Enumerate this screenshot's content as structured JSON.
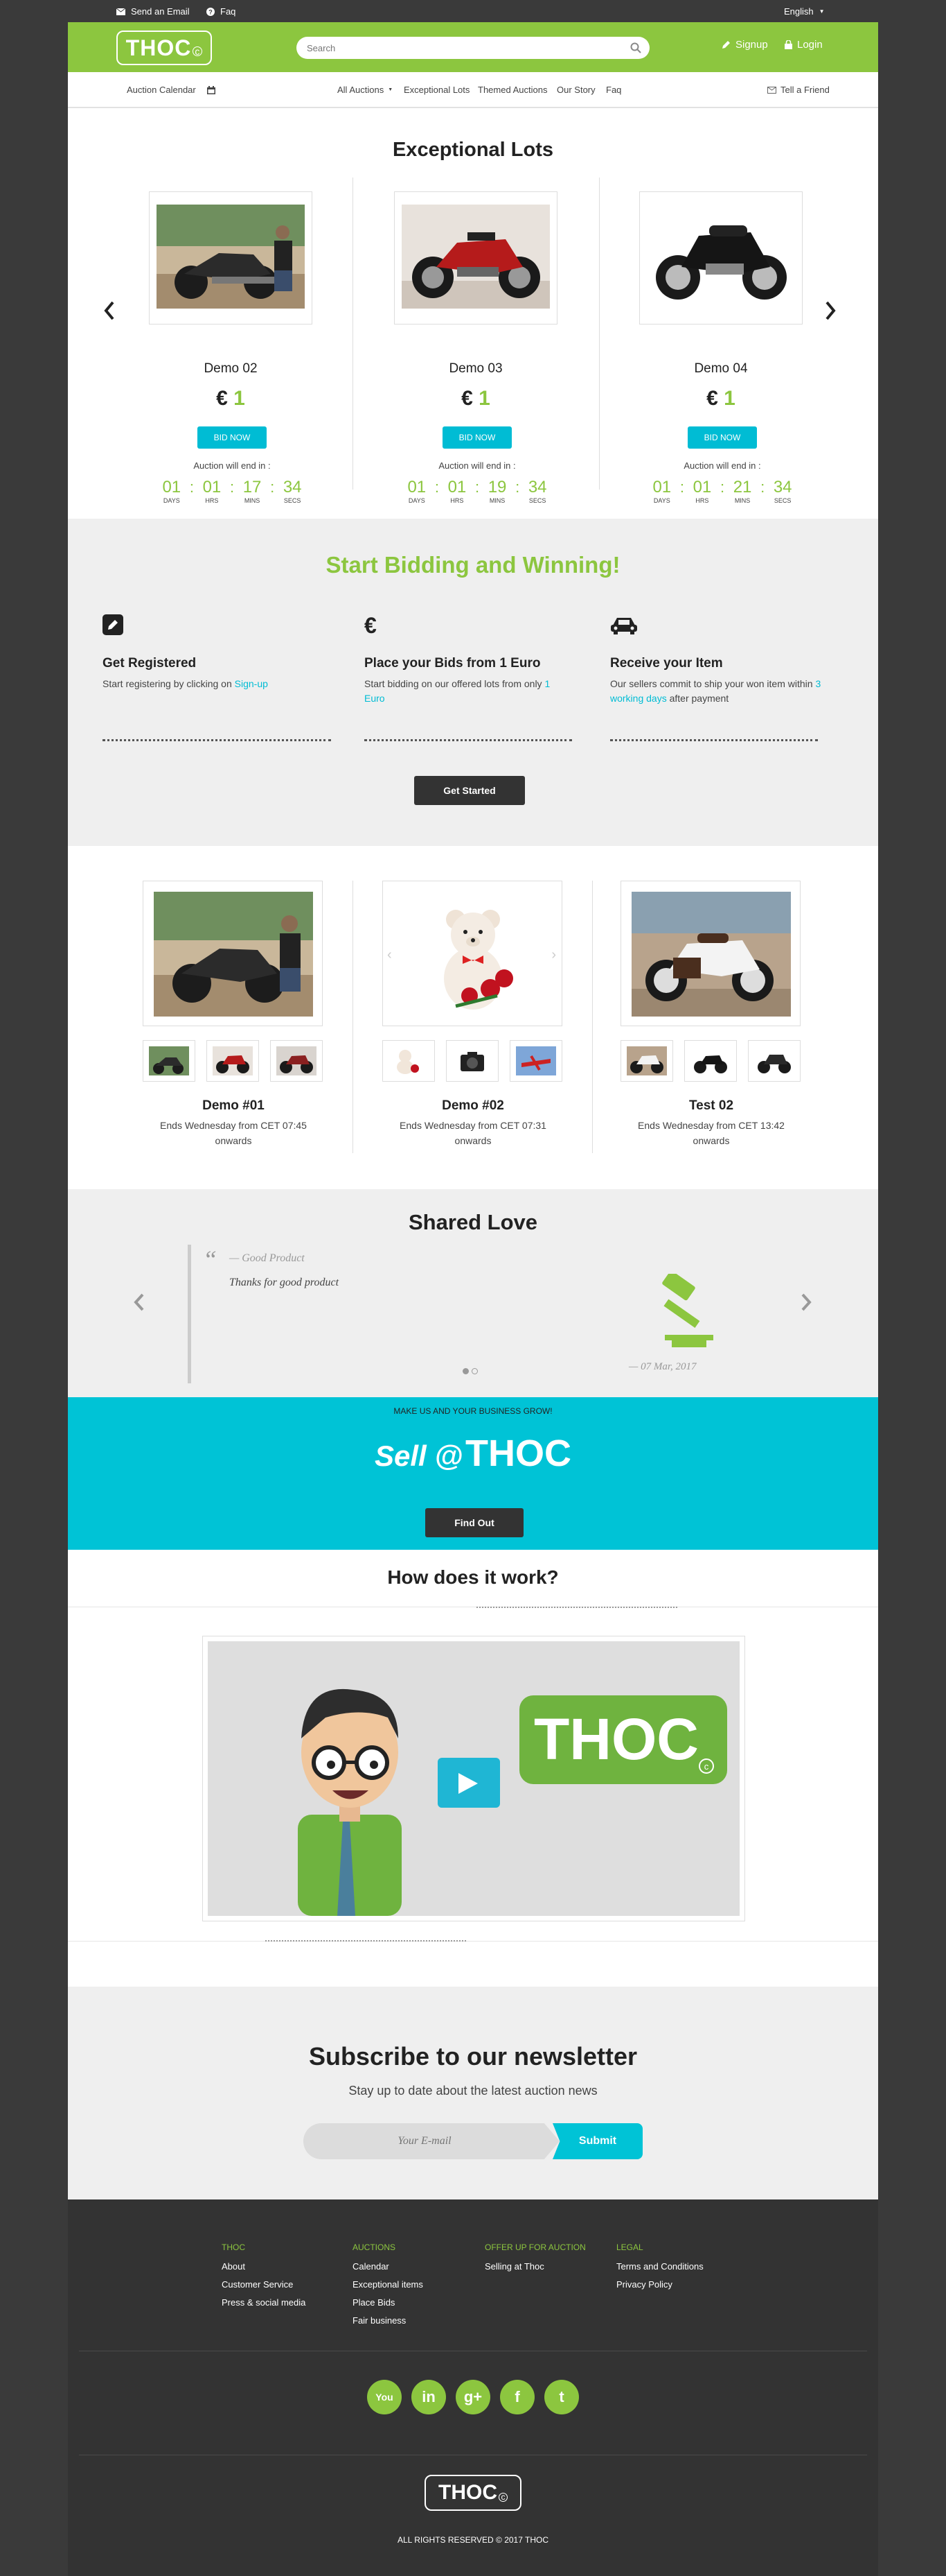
{
  "topbar": {
    "email_label": "Send an Email",
    "faq_label": "Faq",
    "language": "English"
  },
  "header": {
    "logo_text": "THOC",
    "logo_mark": "c",
    "search_placeholder": "Search",
    "signup_label": "Signup",
    "login_label": "Login"
  },
  "nav": {
    "calendar_label": "Auction Calendar",
    "items": [
      "All Auctions",
      "Exceptional Lots",
      "Themed Auctions",
      "Our Story",
      "Faq"
    ],
    "tell_friend": "Tell a Friend"
  },
  "exceptional": {
    "title": "Exceptional Lots",
    "ends_label": "Auction will end in :",
    "bid_label": "BID NOW",
    "units": [
      "DAYS",
      "HRS",
      "MINS",
      "SECS"
    ],
    "lots": [
      {
        "name": "Demo 02",
        "currency": "€",
        "price": "1",
        "days": "01",
        "hrs": "01",
        "mins": "17",
        "secs": "34"
      },
      {
        "name": "Demo 03",
        "currency": "€",
        "price": "1",
        "days": "01",
        "hrs": "01",
        "mins": "19",
        "secs": "34"
      },
      {
        "name": "Demo 04",
        "currency": "€",
        "price": "1",
        "days": "01",
        "hrs": "01",
        "mins": "21",
        "secs": "34"
      }
    ]
  },
  "bidding": {
    "title": "Start Bidding and Winning!",
    "steps": [
      {
        "icon": "pencil-icon",
        "title": "Get Registered",
        "text": "Start registering by clicking on ",
        "link": "Sign-up",
        "text_after": ""
      },
      {
        "icon": "euro-icon",
        "title": "Place your Bids from 1 Euro",
        "text": "Start bidding on our offered lots from only ",
        "link": "1 Euro",
        "text_after": ""
      },
      {
        "icon": "car-icon",
        "title": "Receive your Item",
        "text": "Our sellers commit to ship your won item within ",
        "link": "3 working days",
        "text_after": " after payment"
      }
    ],
    "button": "Get Started"
  },
  "auctions": [
    {
      "name": "Demo #01",
      "ends": "Ends Wednesday from CET 07:45 onwards"
    },
    {
      "name": "Demo #02",
      "ends": "Ends Wednesday from CET 07:31 onwards"
    },
    {
      "name": "Test 02",
      "ends": "Ends Wednesday from CET 13:42 onwards"
    }
  ],
  "love": {
    "title": "Shared Love",
    "quote_title": "— Good Product",
    "quote_text": "Thanks for good product",
    "date": "— 07 Mar, 2017"
  },
  "sell": {
    "tagline": "MAKE US AND YOUR BUSINESS GROW!",
    "sell_word": "Sell @",
    "brand": "THOC",
    "button": "Find Out"
  },
  "how": {
    "title": "How does it work?",
    "video_brand": "THOC"
  },
  "newsletter": {
    "title": "Subscribe to our newsletter",
    "subtitle": "Stay up to date about the latest auction news",
    "placeholder": "Your E-mail",
    "button": "Submit"
  },
  "footer": {
    "columns": [
      {
        "title": "THOC",
        "links": [
          "About",
          "Customer Service",
          "Press & social media"
        ]
      },
      {
        "title": "AUCTIONS",
        "links": [
          "Calendar",
          "Exceptional items",
          "Place Bids",
          "Fair business"
        ]
      },
      {
        "title": "OFFER UP FOR AUCTION",
        "links": [
          "Selling at Thoc"
        ]
      },
      {
        "title": "LEGAL",
        "links": [
          "Terms and Conditions",
          "Privacy Policy"
        ]
      }
    ],
    "social": [
      {
        "name": "youtube-icon",
        "glyph": "You"
      },
      {
        "name": "linkedin-icon",
        "glyph": "in"
      },
      {
        "name": "google-plus-icon",
        "glyph": "g+"
      },
      {
        "name": "facebook-icon",
        "glyph": "f"
      },
      {
        "name": "twitter-icon",
        "glyph": "t"
      }
    ],
    "logo_text": "THOC",
    "copyright": "ALL RIGHTS RESERVED © 2017 THOC"
  },
  "colors": {
    "brand_green": "#8cc63f",
    "accent_cyan": "#00bcd4",
    "dark": "#333333"
  }
}
